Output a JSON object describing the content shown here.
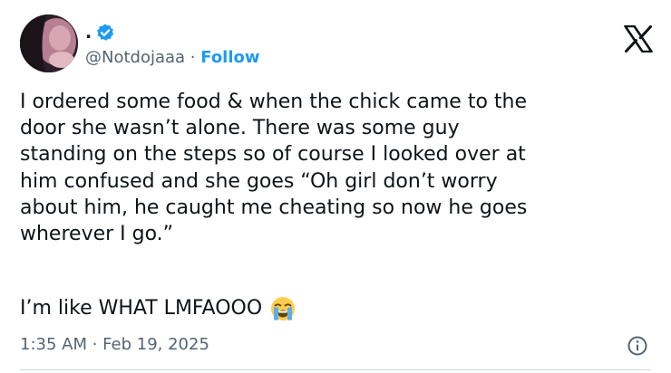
{
  "author": {
    "display_name": ".",
    "handle": "@Notdojaaa",
    "separator": " · ",
    "follow_label": "Follow",
    "verified": true
  },
  "post": {
    "text": "I ordered some food & when the chick came to the\ndoor she wasn’t alone. There was some guy\nstanding on the steps so of course I looked over at\nhim confused and she goes “Oh girl don’t worry\nabout him, he caught me cheating so now he goes\nwherever I go.”",
    "text_second": "I’m like WHAT LMFAOOO",
    "emoji": "loudly-crying-face"
  },
  "footer": {
    "timestamp": "1:35 AM · Feb 19, 2025"
  },
  "icons": {
    "brand": "x-logo-icon",
    "verified": "verified-badge-icon",
    "info": "info-icon"
  },
  "colors": {
    "text": "#0f1419",
    "secondary": "#536471",
    "accent": "#1d9bf0",
    "divider": "#cfd9de"
  }
}
